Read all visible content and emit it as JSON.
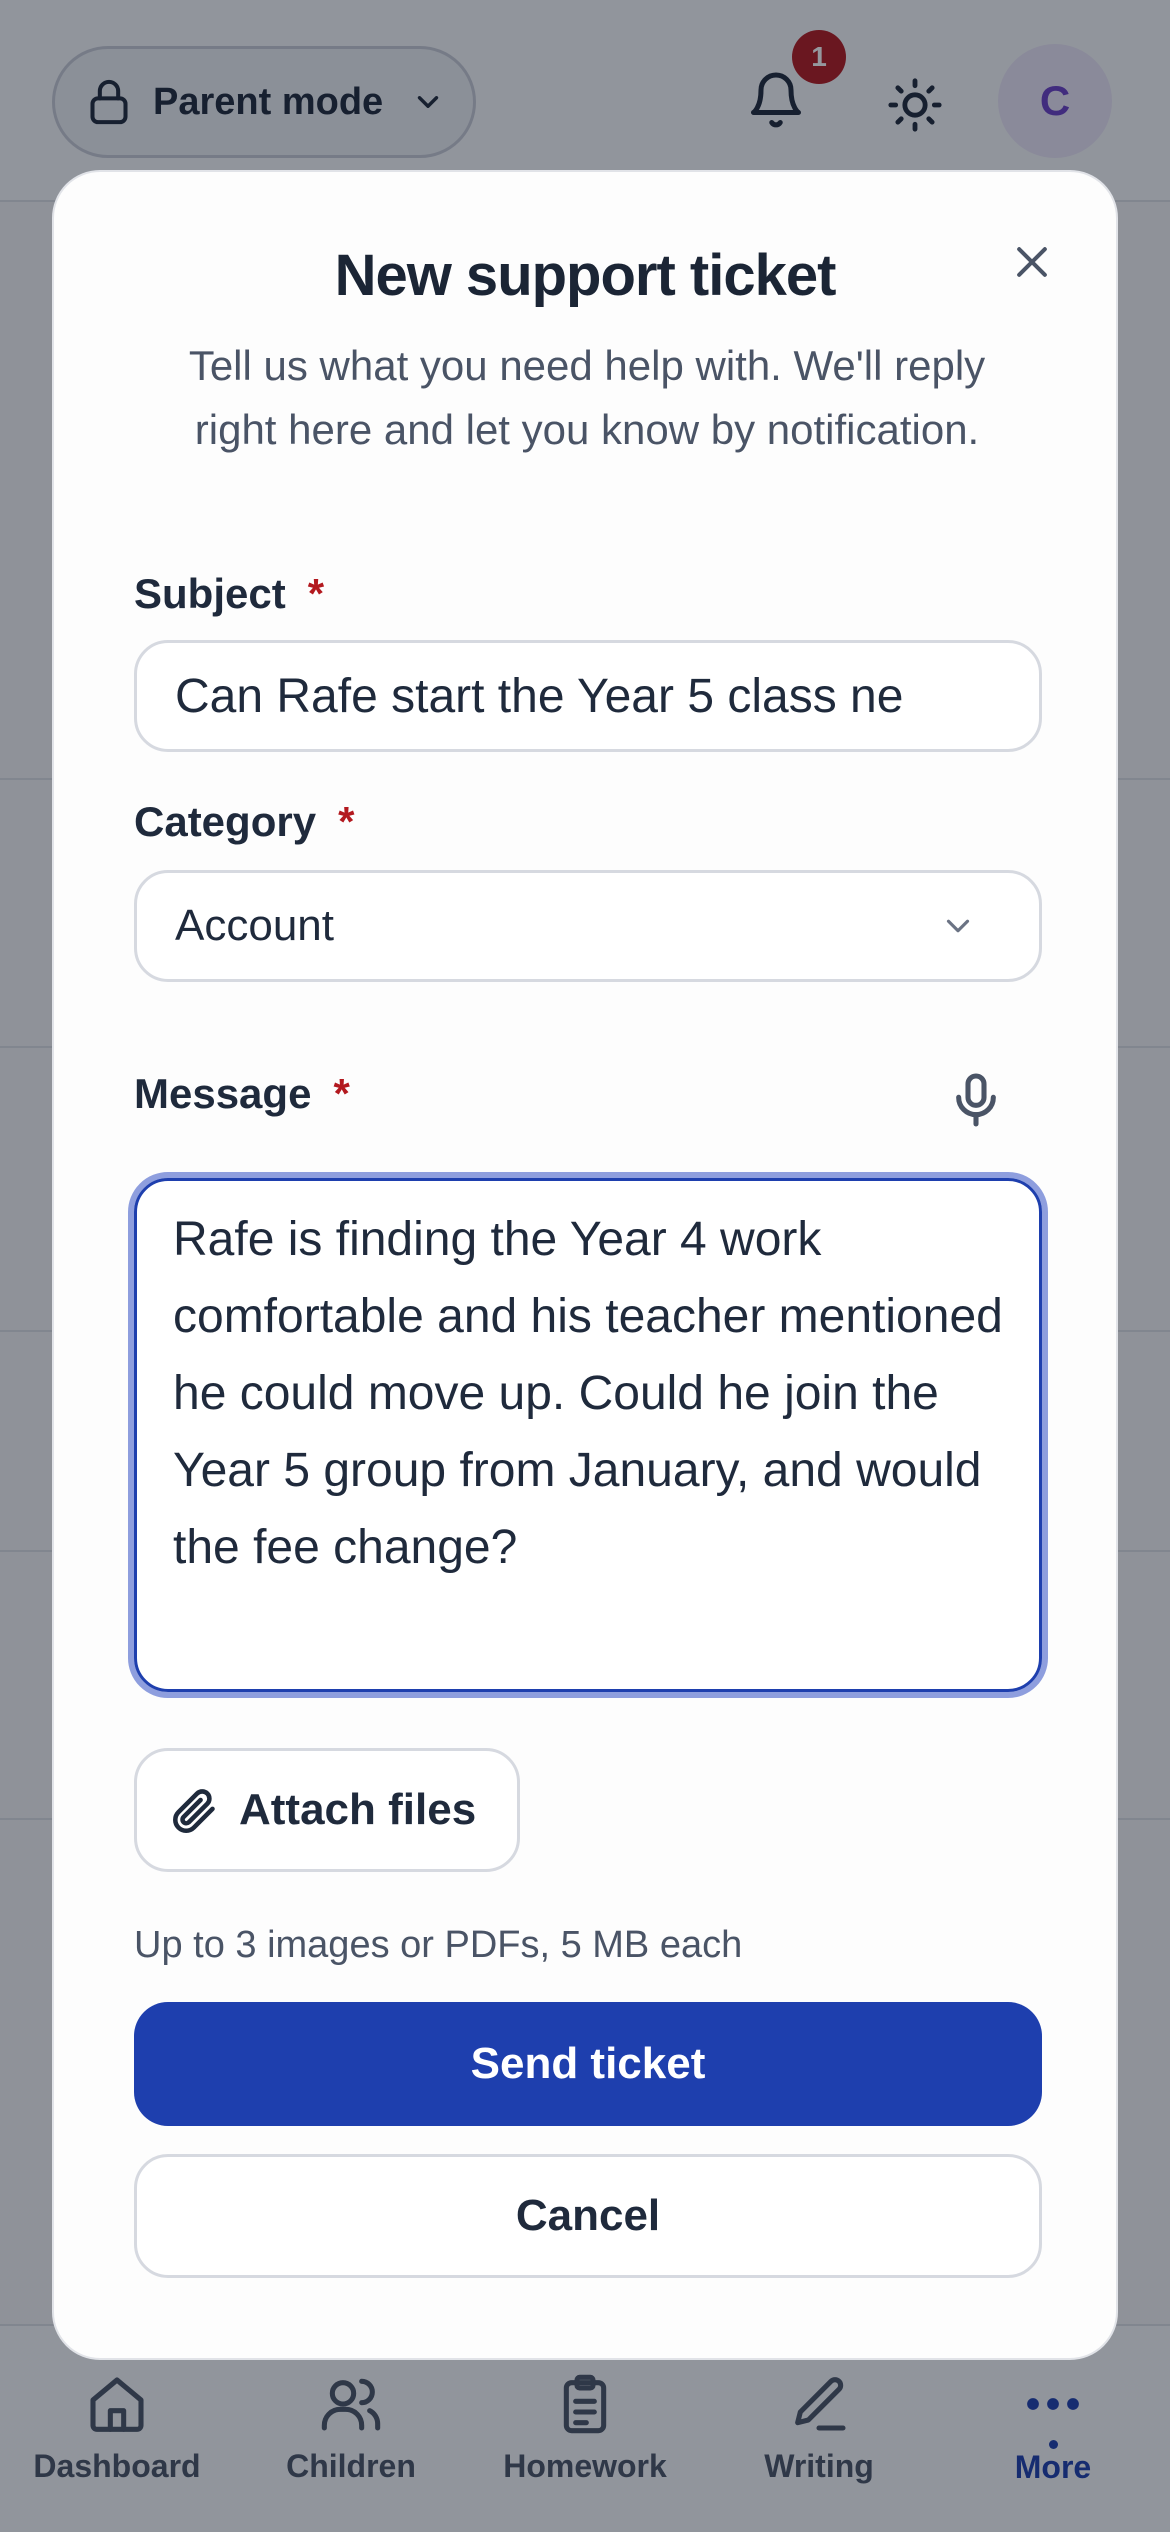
{
  "header": {
    "mode_label": "Parent mode",
    "notification_count": "1",
    "avatar_initial": "C"
  },
  "icons": {
    "mode": "lock-icon",
    "mode_dropdown": "chevron-down-icon",
    "notifications": "bell-icon",
    "theme": "sun-icon",
    "close": "close-icon",
    "category_dropdown": "chevron-down-icon",
    "dictation": "microphone-icon",
    "attach": "paperclip-icon"
  },
  "modal": {
    "title": "New support ticket",
    "subtitle": "Tell us what you need help with. We'll reply right here and let you know by notification.",
    "subject": {
      "label": "Subject",
      "required_marker": "*",
      "value": "Can Rafe start the Year 5 class ne"
    },
    "category": {
      "label": "Category",
      "required_marker": "*",
      "selected": "Account"
    },
    "message": {
      "label": "Message",
      "required_marker": "*",
      "value": "Rafe is finding the Year 4 work comfortable and his teacher mentioned he could move up. Could he join the Year 5 group from January, and would the fee change?"
    },
    "attach_label": "Attach files",
    "attach_hint": "Up to 3 images or PDFs, 5 MB each",
    "send_label": "Send ticket",
    "cancel_label": "Cancel"
  },
  "bottom_nav": {
    "items": [
      {
        "label": "Dashboard",
        "icon": "home-icon"
      },
      {
        "label": "Children",
        "icon": "users-icon"
      },
      {
        "label": "Homework",
        "icon": "clipboard-icon"
      },
      {
        "label": "Writing",
        "icon": "pen-icon"
      },
      {
        "label": "More",
        "icon": "more-icon",
        "active": true
      }
    ]
  },
  "colors": {
    "accent": "#1e3fae",
    "required": "#b3191f",
    "badge": "#b3191f",
    "avatar_text": "#6a3fc6"
  }
}
